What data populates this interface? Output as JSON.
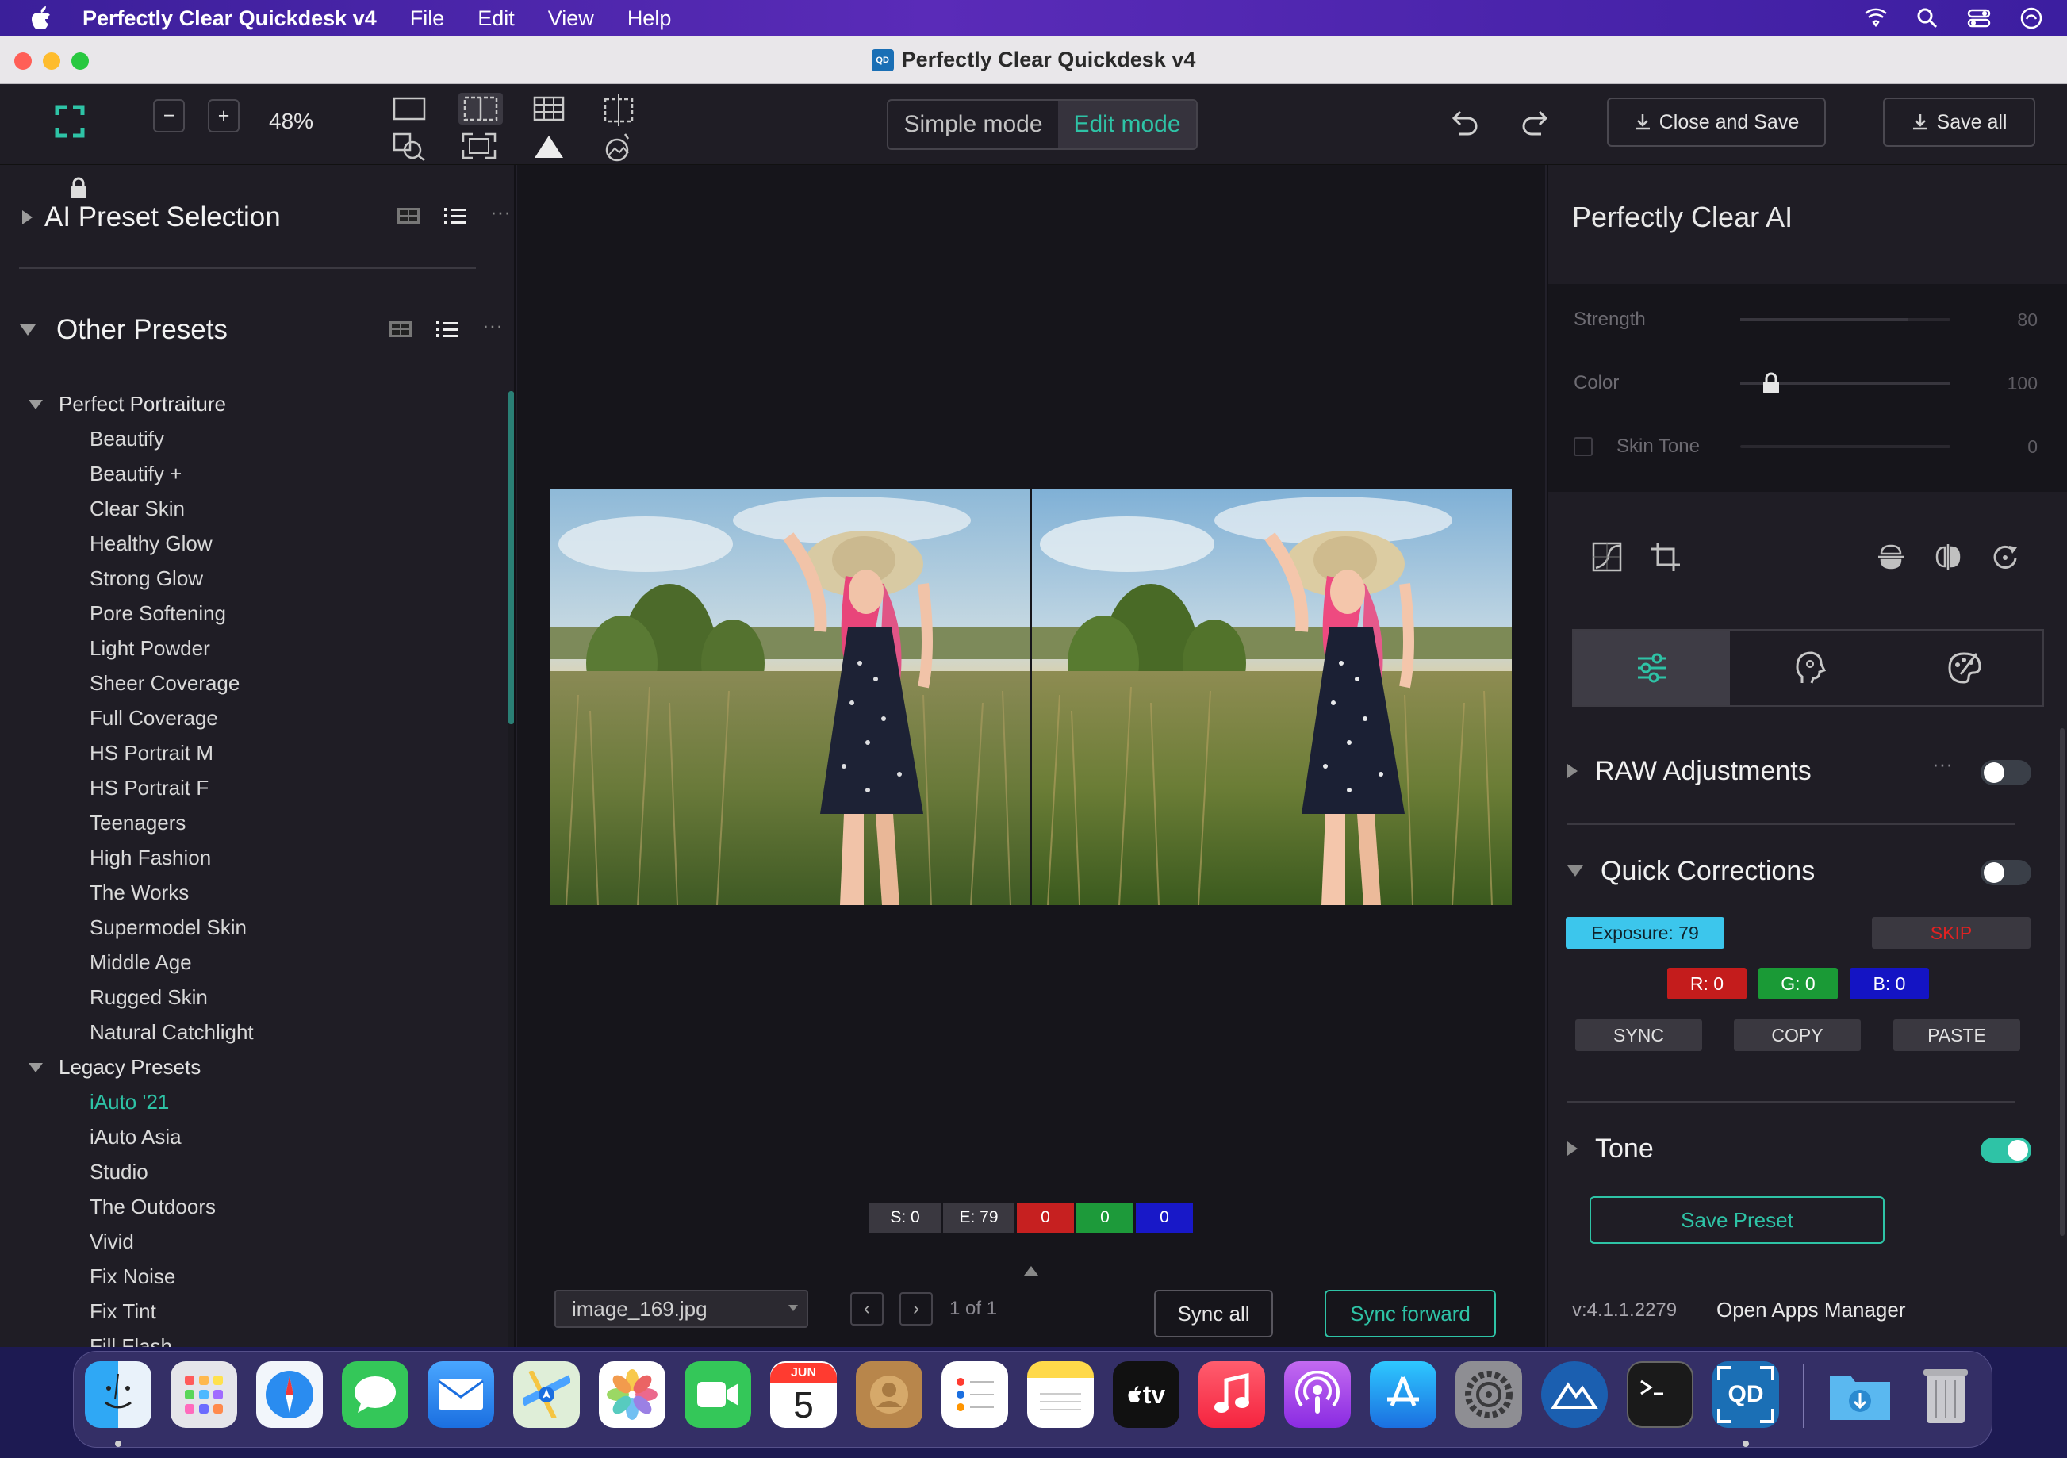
{
  "menubar": {
    "app_name": "Perfectly Clear Quickdesk v4",
    "items": [
      "File",
      "Edit",
      "View",
      "Help"
    ]
  },
  "window": {
    "title": "Perfectly Clear Quickdesk v4",
    "icon_text": "QD"
  },
  "toolbar": {
    "zoom": "48%",
    "minus": "−",
    "plus": "+",
    "mode_simple": "Simple mode",
    "mode_edit": "Edit mode",
    "close_and_save": "Close and Save",
    "save_all": "Save all"
  },
  "left_panel": {
    "ai_section_title": "AI Preset Selection",
    "other_section_title": "Other Presets",
    "groups": [
      {
        "name": "Perfect Portraiture",
        "items": [
          "Beautify",
          "Beautify +",
          "Clear Skin",
          "Healthy Glow",
          "Strong Glow",
          "Pore Softening",
          "Light Powder",
          "Sheer Coverage",
          "Full Coverage",
          "HS Portrait M",
          "HS Portrait F",
          "Teenagers",
          "High Fashion",
          "The Works",
          "Supermodel Skin",
          "Middle Age",
          "Rugged Skin",
          "Natural Catchlight"
        ]
      },
      {
        "name": "Legacy Presets",
        "items": [
          "iAuto '21",
          "iAuto Asia",
          "Studio",
          "The Outdoors",
          "Vivid",
          "Fix Noise",
          "Fix Tint",
          "Fill Flash"
        ]
      }
    ],
    "selected_item": "iAuto '21",
    "accent_color": "#2ec3a6"
  },
  "center": {
    "chips": {
      "s": "S: 0",
      "e": "E: 79",
      "r": "0",
      "g": "0",
      "b": "0"
    },
    "filename": "image_169.jpg",
    "prev": "‹",
    "next": "›",
    "page_info": "1 of 1",
    "sync_all": "Sync all",
    "sync_forward": "Sync forward"
  },
  "right_panel": {
    "title": "Perfectly Clear AI",
    "sliders": [
      {
        "label": "Strength",
        "value": "80",
        "level": 0.8
      },
      {
        "label": "Color",
        "value": "100",
        "level": 1.0
      },
      {
        "label": "Skin Tone",
        "value": "0",
        "level": 0.0
      }
    ],
    "raw_adjustments": "RAW Adjustments",
    "quick_corrections": "Quick Corrections",
    "exposure": "Exposure: 79",
    "skip": "SKIP",
    "r": "R: 0",
    "g": "G: 0",
    "b": "B: 0",
    "sync": "SYNC",
    "copy": "COPY",
    "paste": "PASTE",
    "tone": "Tone",
    "save_preset": "Save Preset",
    "version": "v:4.1.1.2279",
    "open_apps_manager": "Open Apps Manager"
  },
  "dock": {
    "calendar_month": "JUN",
    "calendar_day": "5",
    "tv_label": "tv",
    "qd_label": "QD"
  }
}
